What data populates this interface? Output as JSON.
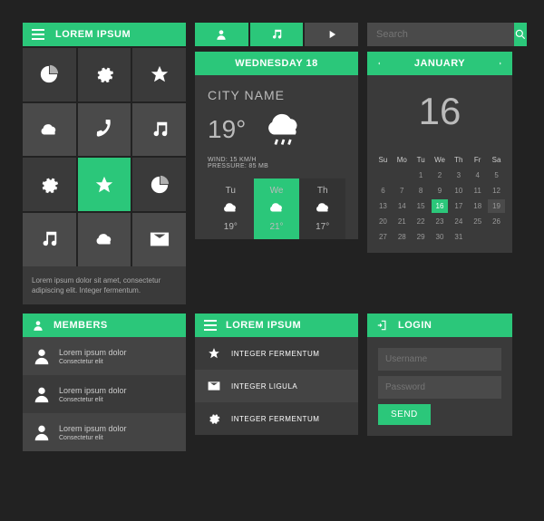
{
  "app_title": "LOREM IPSUM",
  "caption": "Lorem ipsum dolor sit amet, consectetur adipiscing elit. Integer fermentum.",
  "search": {
    "placeholder": "Search"
  },
  "weather": {
    "header": "WEDNESDAY 18",
    "city": "CITY NAME",
    "temp": "19°",
    "wind": "WIND: 15 KM/H",
    "pressure": "PRESSURE: 85 MB",
    "forecast": [
      {
        "day": "Tu",
        "temp": "19°"
      },
      {
        "day": "We",
        "temp": "21°"
      },
      {
        "day": "Th",
        "temp": "17°"
      }
    ]
  },
  "calendar": {
    "month": "JANUARY",
    "big_date": "16",
    "weekdays": [
      "Su",
      "Mo",
      "Tu",
      "We",
      "Th",
      "Fr",
      "Sa"
    ],
    "days": [
      [
        "",
        "",
        "1",
        "2",
        "3",
        "4",
        "5"
      ],
      [
        "6",
        "7",
        "8",
        "9",
        "10",
        "11",
        "12"
      ],
      [
        "13",
        "14",
        "15",
        "16",
        "17",
        "18",
        "19"
      ],
      [
        "20",
        "21",
        "22",
        "23",
        "24",
        "25",
        "26"
      ],
      [
        "27",
        "28",
        "29",
        "30",
        "31",
        "",
        ""
      ]
    ],
    "selected": "16",
    "hover": "19"
  },
  "members": {
    "title": "MEMBERS",
    "items": [
      {
        "name": "Lorem ipsum dolor",
        "sub": "Consectetur elit"
      },
      {
        "name": "Lorem ipsum dolor",
        "sub": "Consectetur elit"
      },
      {
        "name": "Lorem ipsum dolor",
        "sub": "Consectetur elit"
      }
    ]
  },
  "menu": {
    "title": "LOREM IPSUM",
    "items": [
      {
        "label": "INTEGER FERMENTUM"
      },
      {
        "label": "INTEGER LIGULA"
      },
      {
        "label": "INTEGER FERMENTUM"
      }
    ]
  },
  "login": {
    "title": "LOGIN",
    "username": "Username",
    "password": "Password",
    "send": "SEND"
  }
}
